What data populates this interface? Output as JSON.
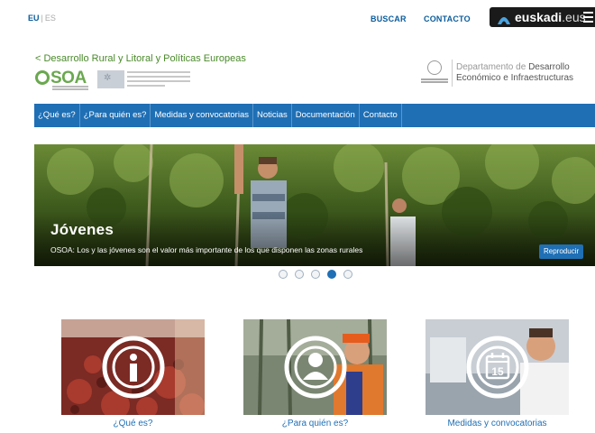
{
  "topbar": {
    "lang_active": "EU",
    "lang_separator": "|",
    "lang_other": "ES",
    "search_label": "BUSCAR",
    "contact_label": "CONTACTO",
    "portal_name": "euskadi",
    "portal_suffix": ".eus"
  },
  "header": {
    "back_link": "< Desarrollo Rural y Litoral y Políticas Europeas",
    "logo_text": "SOA",
    "logo_letter": "O",
    "department_line1_prefix": "Departamento de ",
    "department_line1_bold": "Desarrollo",
    "department_line2": "Económico e Infraestructuras"
  },
  "nav": {
    "items": [
      "¿Qué es?",
      "¿Para quién es?",
      "Medidas y convocatorias",
      "Noticias",
      "Documentación",
      "Contacto"
    ]
  },
  "hero": {
    "title": "Jóvenes",
    "caption": "OSOA: Los y las jóvenes son el valor más importante de los que disponen las zonas rurales",
    "play_label": "Reproducir",
    "slide_count": 5,
    "active_slide": 4
  },
  "cards": [
    {
      "label": "¿Qué es?",
      "icon": "info-icon"
    },
    {
      "label": "¿Para quién es?",
      "icon": "person-icon"
    },
    {
      "label": "Medidas y convocatorias",
      "icon": "calendar-icon",
      "icon_text": "15"
    }
  ],
  "colors": {
    "brand_blue": "#1f6fb5",
    "osoa_green": "#6aa84f",
    "topbar_link": "#0a5c9c"
  }
}
